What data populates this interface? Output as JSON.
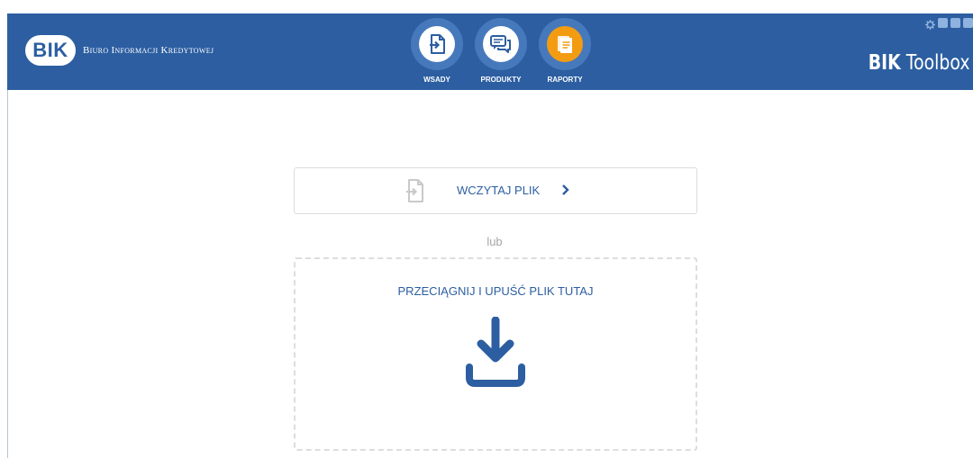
{
  "header": {
    "logo_mark": "BIK",
    "logo_text": "Biuro Informacji Kredytowej",
    "app_title_bold": "BIK",
    "app_title_rest": "Toolbox",
    "accent_color": "#2c5ea1",
    "active_color": "#f39c12"
  },
  "nav": {
    "items": [
      {
        "label": "WSADY",
        "icon": "file-import-icon"
      },
      {
        "label": "PRODUKTY",
        "icon": "chat-bubbles-icon"
      },
      {
        "label": "RAPORTY",
        "icon": "report-document-icon",
        "active": true
      }
    ]
  },
  "window_controls": [
    "gear-icon",
    "minimize-icon",
    "maximize-icon",
    "close-icon"
  ],
  "main": {
    "load_button_label": "WCZYTAJ PLIK",
    "or_text": "lub",
    "drop_label": "PRZECIĄGNIJ I UPUŚĆ PLIK TUTAJ"
  }
}
